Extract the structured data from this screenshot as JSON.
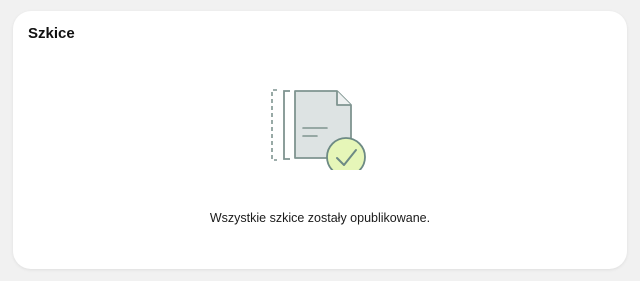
{
  "card": {
    "title": "Szkice",
    "illustration_icon": "document-check-icon",
    "empty_message": "Wszystkie szkice zostały opublikowane."
  },
  "colors": {
    "page_background": "#f1f1f1",
    "card_background": "#ffffff",
    "document_fill": "#dde3e3",
    "document_stroke": "#7f9490",
    "check_fill": "#e6f6b8",
    "check_stroke": "#6d8a84"
  }
}
